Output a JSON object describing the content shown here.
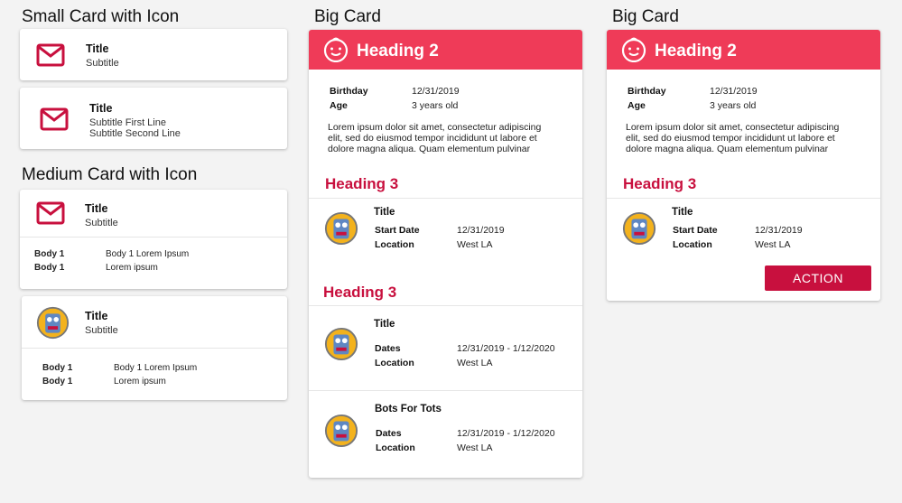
{
  "colors": {
    "accent": "#c8103e",
    "header": "#ef3b58",
    "background": "#f3f3f3"
  },
  "sections": {
    "small": "Small Card with Icon",
    "medium": "Medium Card with Icon",
    "big1": "Big Card",
    "big2": "Big Card"
  },
  "small_cards": [
    {
      "icon": "mail-icon",
      "title": "Title",
      "subtitle": "Subtitle"
    },
    {
      "icon": "mail-icon",
      "title": "Title",
      "subtitle_line1": "Subtitle First Line",
      "subtitle_line2": "Subtitle Second Line"
    }
  ],
  "medium_cards": [
    {
      "icon": "mail-icon",
      "title": "Title",
      "subtitle": "Subtitle",
      "rows": [
        {
          "label": "Body 1",
          "value": "Body 1 Lorem Ipsum"
        },
        {
          "label": "Body 1",
          "value": "Lorem ipsum"
        }
      ]
    },
    {
      "icon": "robot-avatar-icon",
      "title": "Title",
      "subtitle": "Subtitle",
      "rows": [
        {
          "label": "Body 1",
          "value": "Body 1 Lorem Ipsum"
        },
        {
          "label": "Body 1",
          "value": "Lorem ipsum"
        }
      ]
    }
  ],
  "big_card_1": {
    "heading2": "Heading 2",
    "birthday_label": "Birthday",
    "birthday_value": "12/31/2019",
    "age_label": "Age",
    "age_value": "3 years old",
    "para_line1": "Lorem ipsum dolor sit amet, consectetur adipiscing",
    "para_line2": "elit, sed do eiusmod tempor incididunt ut labore et",
    "para_line3": "dolore magna aliqua. Quam elementum pulvinar",
    "heading3_a": "Heading 3",
    "item1": {
      "title": "Title",
      "k1": "Start Date",
      "v1": "12/31/2019",
      "k2": "Location",
      "v2": "West LA"
    },
    "heading3_b": "Heading 3",
    "item2": {
      "title": "Title",
      "k1": "Dates",
      "v1": "12/31/2019 - 1/12/2020",
      "k2": "Location",
      "v2": "West LA"
    },
    "item3": {
      "title": "Bots For Tots",
      "k1": "Dates",
      "v1": "12/31/2019 - 1/12/2020",
      "k2": "Location",
      "v2": "West LA"
    }
  },
  "big_card_2": {
    "heading2": "Heading 2",
    "birthday_label": "Birthday",
    "birthday_value": "12/31/2019",
    "age_label": "Age",
    "age_value": "3 years old",
    "para_line1": "Lorem ipsum dolor sit amet, consectetur adipiscing",
    "para_line2": "elit, sed do eiusmod tempor incididunt ut labore et",
    "para_line3": "dolore magna aliqua. Quam elementum pulvinar",
    "heading3": "Heading 3",
    "item1": {
      "title": "Title",
      "k1": "Start Date",
      "v1": "12/31/2019",
      "k2": "Location",
      "v2": "West LA"
    },
    "action_label": "ACTION"
  }
}
